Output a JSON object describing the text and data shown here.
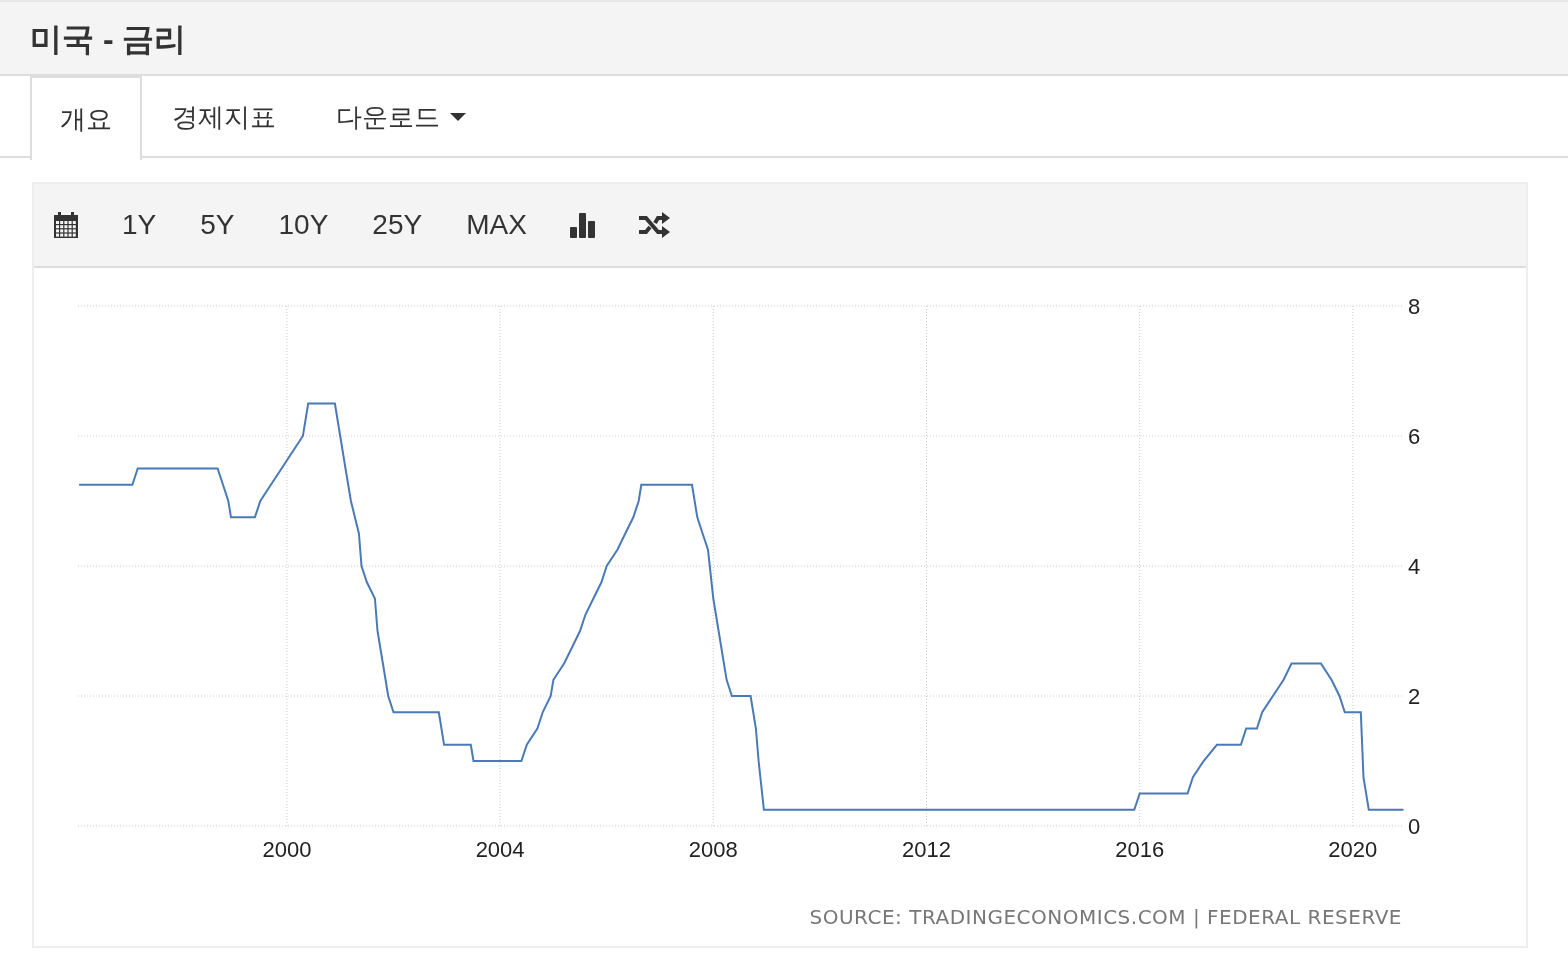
{
  "header": {
    "title": "미국 - 금리"
  },
  "tabs": [
    {
      "label": "개요",
      "selected": true,
      "kind": "plain"
    },
    {
      "label": "경제지표",
      "selected": false,
      "kind": "plain"
    },
    {
      "label": "다운로드",
      "selected": false,
      "kind": "dropdown"
    }
  ],
  "toolbar": {
    "ranges": [
      "1Y",
      "5Y",
      "10Y",
      "25Y",
      "MAX"
    ]
  },
  "chart": {
    "chart_data": {
      "type": "line",
      "x": [
        1996.1,
        1997.1,
        1997.2,
        1998.7,
        1998.8,
        1998.9,
        1998.95,
        1999.4,
        1999.5,
        1999.7,
        1999.9,
        2000.1,
        2000.3,
        2000.4,
        2000.9,
        2001.0,
        2001.1,
        2001.2,
        2001.35,
        2001.4,
        2001.5,
        2001.65,
        2001.7,
        2001.8,
        2001.9,
        2002.0,
        2002.85,
        2002.95,
        2003.45,
        2003.5,
        2004.4,
        2004.5,
        2004.7,
        2004.8,
        2004.95,
        2005.0,
        2005.2,
        2005.35,
        2005.5,
        2005.6,
        2005.75,
        2005.9,
        2006.0,
        2006.2,
        2006.35,
        2006.5,
        2006.6,
        2006.65,
        2007.6,
        2007.7,
        2007.8,
        2007.9,
        2008.0,
        2008.1,
        2008.25,
        2008.35,
        2008.7,
        2008.8,
        2008.85,
        2008.95,
        2015.9,
        2016.0,
        2016.9,
        2017.0,
        2017.2,
        2017.45,
        2017.9,
        2018.0,
        2018.2,
        2018.3,
        2018.5,
        2018.7,
        2018.85,
        2019.4,
        2019.6,
        2019.75,
        2019.85,
        2020.15,
        2020.2,
        2020.3,
        2020.95
      ],
      "series": [
        {
          "color": "#4a7ab5",
          "values": [
            5.25,
            5.25,
            5.5,
            5.5,
            5.25,
            5.0,
            4.75,
            4.75,
            5.0,
            5.25,
            5.5,
            5.75,
            6.0,
            6.5,
            6.5,
            6.0,
            5.5,
            5.0,
            4.5,
            4.0,
            3.75,
            3.5,
            3.0,
            2.5,
            2.0,
            1.75,
            1.75,
            1.25,
            1.25,
            1.0,
            1.0,
            1.25,
            1.5,
            1.75,
            2.0,
            2.25,
            2.5,
            2.75,
            3.0,
            3.25,
            3.5,
            3.75,
            4.0,
            4.25,
            4.5,
            4.75,
            5.0,
            5.25,
            5.25,
            4.75,
            4.5,
            4.25,
            3.5,
            3.0,
            2.25,
            2.0,
            2.0,
            1.5,
            1.0,
            0.25,
            0.25,
            0.5,
            0.5,
            0.75,
            1.0,
            1.25,
            1.25,
            1.5,
            1.5,
            1.75,
            2.0,
            2.25,
            2.5,
            2.5,
            2.25,
            2.0,
            1.75,
            1.75,
            0.75,
            0.25,
            0.25
          ]
        }
      ],
      "grid": true,
      "xlim": [
        1996.08,
        2020.96
      ],
      "ylim": [
        0,
        8
      ],
      "xticks": [
        2000,
        2004,
        2008,
        2012,
        2016,
        2020
      ],
      "yticks": [
        0,
        2,
        4,
        6,
        8
      ]
    },
    "source": "SOURCE: TRADINGECONOMICS.COM | FEDERAL RESERVE"
  }
}
